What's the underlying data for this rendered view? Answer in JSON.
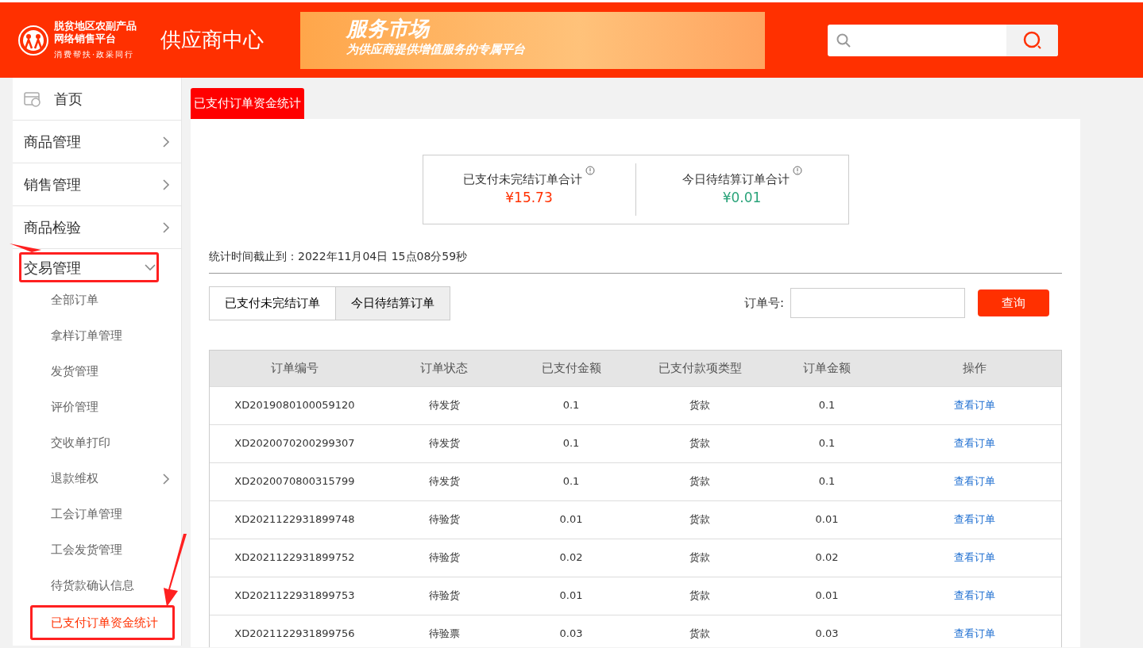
{
  "header": {
    "logo_lines": [
      "脱贫地区农副产品",
      "网络销售平台",
      "消费帮扶·政采同行"
    ],
    "title": "供应商中心",
    "banner": {
      "headline": "服务市场",
      "subline": "为供应商提供增值服务的专属平台"
    }
  },
  "sidebar": {
    "items": [
      {
        "label": "首页",
        "kind": "home",
        "selected": false
      },
      {
        "label": "商品管理",
        "kind": "group",
        "expanded": false,
        "selected": false
      },
      {
        "label": "销售管理",
        "kind": "group",
        "expanded": false,
        "selected": false
      },
      {
        "label": "商品检验",
        "kind": "group",
        "expanded": false,
        "selected": false
      },
      {
        "label": "交易管理",
        "kind": "group",
        "expanded": true,
        "selected": false,
        "annotated": true,
        "children": [
          {
            "label": "全部订单",
            "selected": false
          },
          {
            "label": "拿样订单管理",
            "selected": false
          },
          {
            "label": "发货管理",
            "selected": false
          },
          {
            "label": "评价管理",
            "selected": false
          },
          {
            "label": "交收单打印",
            "selected": false
          },
          {
            "label": "退款维权",
            "has_submenu": true,
            "selected": false
          },
          {
            "label": "工会订单管理",
            "selected": false
          },
          {
            "label": "工会发货管理",
            "selected": false
          },
          {
            "label": "待货款确认信息",
            "selected": false
          },
          {
            "label": "已支付订单资金统计",
            "selected": true,
            "annotated": true
          }
        ]
      }
    ]
  },
  "page_tab": "已支付订单资金统计",
  "summary": [
    {
      "label": "已支付未完结订单合计",
      "value": "¥15.73",
      "color": "#ff3000"
    },
    {
      "label": "今日待结算订单合计",
      "value": "¥0.01",
      "color": "#2aa37a"
    }
  ],
  "stat_time": "统计时间截止到：2022年11月04日 15点08分59秒",
  "tabs": [
    {
      "label": "已支付未完结订单",
      "selected": true
    },
    {
      "label": "今日待结算订单",
      "selected": false
    }
  ],
  "search": {
    "label": "订单号:",
    "button": "查询"
  },
  "table": {
    "columns": [
      "订单编号",
      "订单状态",
      "已支付金额",
      "已支付款项类型",
      "订单金额",
      "操作"
    ],
    "rows": [
      [
        "XD2019080100059120",
        "待发货",
        "0.1",
        "货款",
        "0.1",
        "查看订单"
      ],
      [
        "XD2020070200299307",
        "待发货",
        "0.1",
        "货款",
        "0.1",
        "查看订单"
      ],
      [
        "XD2020070800315799",
        "待发货",
        "0.1",
        "货款",
        "0.1",
        "查看订单"
      ],
      [
        "XD2021122931899748",
        "待验货",
        "0.01",
        "货款",
        "0.01",
        "查看订单"
      ],
      [
        "XD2021122931899752",
        "待验货",
        "0.02",
        "货款",
        "0.02",
        "查看订单"
      ],
      [
        "XD2021122931899753",
        "待验货",
        "0.01",
        "货款",
        "0.01",
        "查看订单"
      ],
      [
        "XD2021122931899756",
        "待验票",
        "0.03",
        "货款",
        "0.03",
        "查看订单"
      ]
    ]
  }
}
